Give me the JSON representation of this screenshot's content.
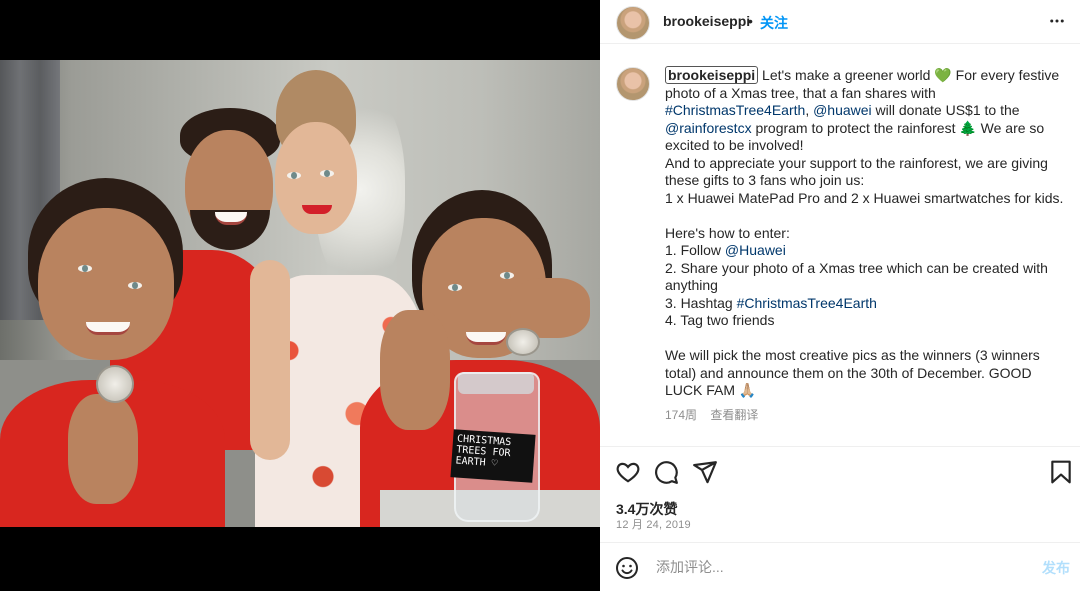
{
  "post": {
    "username": "brookeiseppi",
    "separator": "•",
    "follow_label": "关注",
    "caption": {
      "username": "brookeiseppi",
      "line1_text": " Let's make a greener world ",
      "emoji_heart": "💚",
      "line1_rest": " For every festive photo of a Xmas tree, that a fan shares with ",
      "hashtag1": "#ChristmasTree4Earth",
      "comma": ", ",
      "mention_huawei": "@huawei",
      "donate_text": " will donate US$1 to the ",
      "mention_rainforest": "@rainforestcx",
      "protect_text": " program to protect the rainforest ",
      "emoji_tree": "🌲",
      "excited_text": " We are so excited to be involved!",
      "para2": "And to appreciate your support to the rainforest, we are giving these gifts to 3 fans who join us:",
      "para3": "1 x Huawei MatePad Pro and 2 x Huawei smartwatches for kids.",
      "howto": "Here's how to enter:",
      "step1_prefix": "1. Follow ",
      "step1_link": "@Huawei",
      "step2": "2. Share your photo of a Xmas tree which can be created with anything",
      "step3_prefix": "3. Hashtag ",
      "step3_link": "#ChristmasTree4Earth",
      "step4": "4. Tag two friends",
      "closing": "We will pick the most creative pics as the winners (3 winners total) and announce them on the 30th of December. GOOD LUCK FAM ",
      "closing_emoji": "🙏🏼"
    },
    "time_ago": "174周",
    "translate_label": "查看翻译",
    "likes": "3.4万次赞",
    "date": "12 月 24, 2019"
  },
  "photo": {
    "jar_label": "CHRISTMAS\nTREES FOR\nEARTH ♡"
  },
  "comment": {
    "placeholder": "添加评论...",
    "post_label": "发布"
  },
  "icons": {
    "more": "more-options-icon",
    "like": "heart-icon",
    "comment": "comment-bubble-icon",
    "share": "paper-plane-icon",
    "save": "bookmark-icon",
    "emoji": "smiley-icon",
    "tag": "person-tag-icon"
  },
  "colors": {
    "link": "#00376b",
    "follow": "#0095f6",
    "muted": "#8e8e8e",
    "post_disabled": "#b2dffc"
  }
}
